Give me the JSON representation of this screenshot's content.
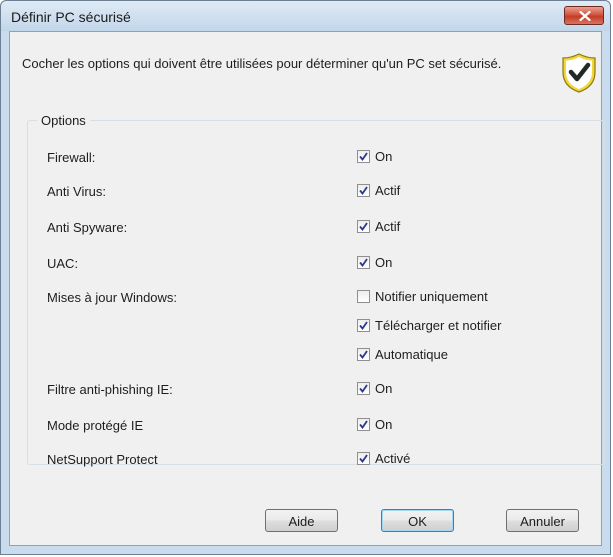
{
  "window": {
    "title": "Définir PC sécurisé"
  },
  "intro": "Cocher les options qui doivent être utilisées pour déterminer qu'un PC set sécurisé.",
  "icons": {
    "shield": "shield-check-icon",
    "close": "close-icon"
  },
  "options_group": {
    "title": "Options",
    "rows": [
      {
        "label": "Firewall:",
        "options": [
          {
            "text": "On",
            "checked": true
          }
        ]
      },
      {
        "label": "Anti Virus:",
        "options": [
          {
            "text": "Actif",
            "checked": true
          }
        ]
      },
      {
        "label": "Anti Spyware:",
        "options": [
          {
            "text": "Actif",
            "checked": true
          }
        ]
      },
      {
        "label": "UAC:",
        "options": [
          {
            "text": "On",
            "checked": true
          }
        ]
      },
      {
        "label": "Mises à jour Windows:",
        "options": [
          {
            "text": "Notifier uniquement",
            "checked": false
          },
          {
            "text": "Télécharger et notifier",
            "checked": true
          },
          {
            "text": "Automatique",
            "checked": true
          }
        ]
      },
      {
        "label": "Filtre anti-phishing IE:",
        "options": [
          {
            "text": "On",
            "checked": true
          }
        ]
      },
      {
        "label": "Mode protégé IE",
        "options": [
          {
            "text": "On",
            "checked": true
          }
        ]
      },
      {
        "label": "NetSupport Protect",
        "options": [
          {
            "text": "Activé",
            "checked": true
          }
        ]
      }
    ]
  },
  "buttons": {
    "help": "Aide",
    "ok": "OK",
    "cancel": "Annuler"
  },
  "colors": {
    "title_bar": "#c9dcee",
    "close_button": "#c33d24",
    "shield": "#e6c61e",
    "checkmark": "#2a3a8a"
  }
}
